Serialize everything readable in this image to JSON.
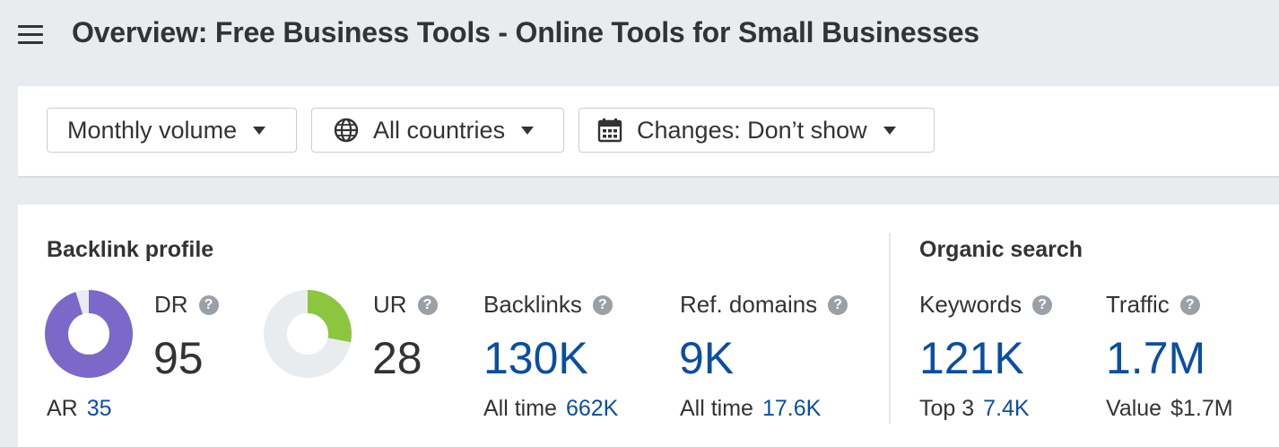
{
  "header": {
    "title": "Overview: Free Business Tools - Online Tools for Small Businesses"
  },
  "toolbar": {
    "volume_label": "Monthly volume",
    "countries_label": "All countries",
    "changes_label": "Changes: Don’t show"
  },
  "backlink_profile": {
    "title": "Backlink profile",
    "dr": {
      "label": "DR",
      "value": "95",
      "level": 95,
      "color": "#7b68c8"
    },
    "ar": {
      "label": "AR",
      "value": "35"
    },
    "ur": {
      "label": "UR",
      "value": "28",
      "level": 28,
      "color": "#8cc63f"
    },
    "backlinks": {
      "label": "Backlinks",
      "value": "130K",
      "sub_label": "All time",
      "sub_value": "662K"
    },
    "ref_domains": {
      "label": "Ref. domains",
      "value": "9K",
      "sub_label": "All time",
      "sub_value": "17.6K"
    }
  },
  "organic_search": {
    "title": "Organic search",
    "keywords": {
      "label": "Keywords",
      "value": "121K",
      "sub_label": "Top 3",
      "sub_value": "7.4K"
    },
    "traffic": {
      "label": "Traffic",
      "value": "1.7M",
      "sub_label": "Value",
      "sub_value": "$1.7M"
    }
  },
  "icons": {
    "menu": "hamburger-icon",
    "globe": "globe-icon",
    "calendar": "calendar-icon",
    "help": "question-mark-icon"
  },
  "colors": {
    "link_blue": "#0a4ea3",
    "donut_track": "#e9ecef"
  }
}
